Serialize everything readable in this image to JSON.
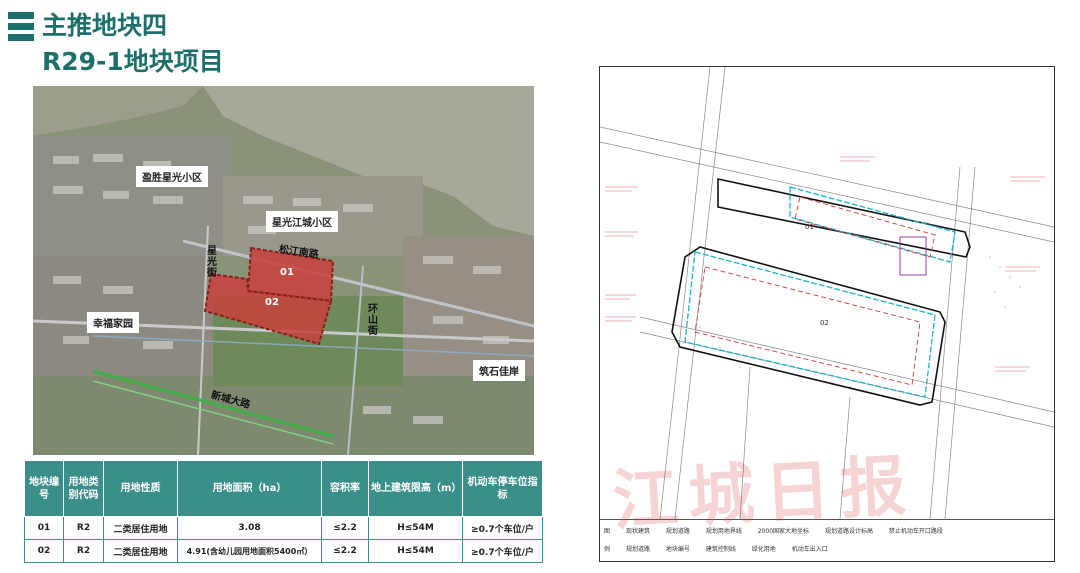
{
  "header": {
    "title_line1": "主推地块四",
    "title_line2": "R29-1地块项目"
  },
  "map_labels": {
    "yingsheng": "盈胜星光小区",
    "xingguang": "星光江城小区",
    "songjiang_road": "松江南路",
    "xingguang_street": "星光街",
    "huanshan_street": "环山街",
    "xingfu": "幸福家园",
    "zhuoshi": "筑石佳岸",
    "xincheng_road": "新城大路",
    "plot_01": "01",
    "plot_02": "02"
  },
  "table": {
    "headers": [
      "地块编号",
      "用地类别代码",
      "用地性质",
      "用地面积（ha）",
      "容积率",
      "地上建筑限高（m）",
      "机动车停车位指标"
    ],
    "rows": [
      [
        "01",
        "R2",
        "二类居住用地",
        "3.08",
        "≤2.2",
        "H≤54M",
        "≥0.7个车位/户"
      ],
      [
        "02",
        "R2",
        "二类居住用地",
        "4.91(含幼儿园用地面积5400㎡）",
        "≤2.2",
        "H≤54M",
        "≥0.7个车位/户"
      ]
    ]
  },
  "plan": {
    "plot_01": "01",
    "plot_02": "02",
    "legend_row1": [
      "图",
      "现状建筑",
      "规划道路",
      "规划用地界线",
      "2000国家大地坐标",
      "规划道路设计标高",
      "禁止机动车开口路段"
    ],
    "legend_row2": [
      "例",
      "规划道路",
      "地块编号",
      "建筑控制线",
      "绿化用地",
      "机动车出入口"
    ]
  },
  "watermark": "江城日报",
  "colors": {
    "accent": "#1d6f6b",
    "table_header": "#3a8f8b",
    "plot_red": "#c8403c"
  }
}
